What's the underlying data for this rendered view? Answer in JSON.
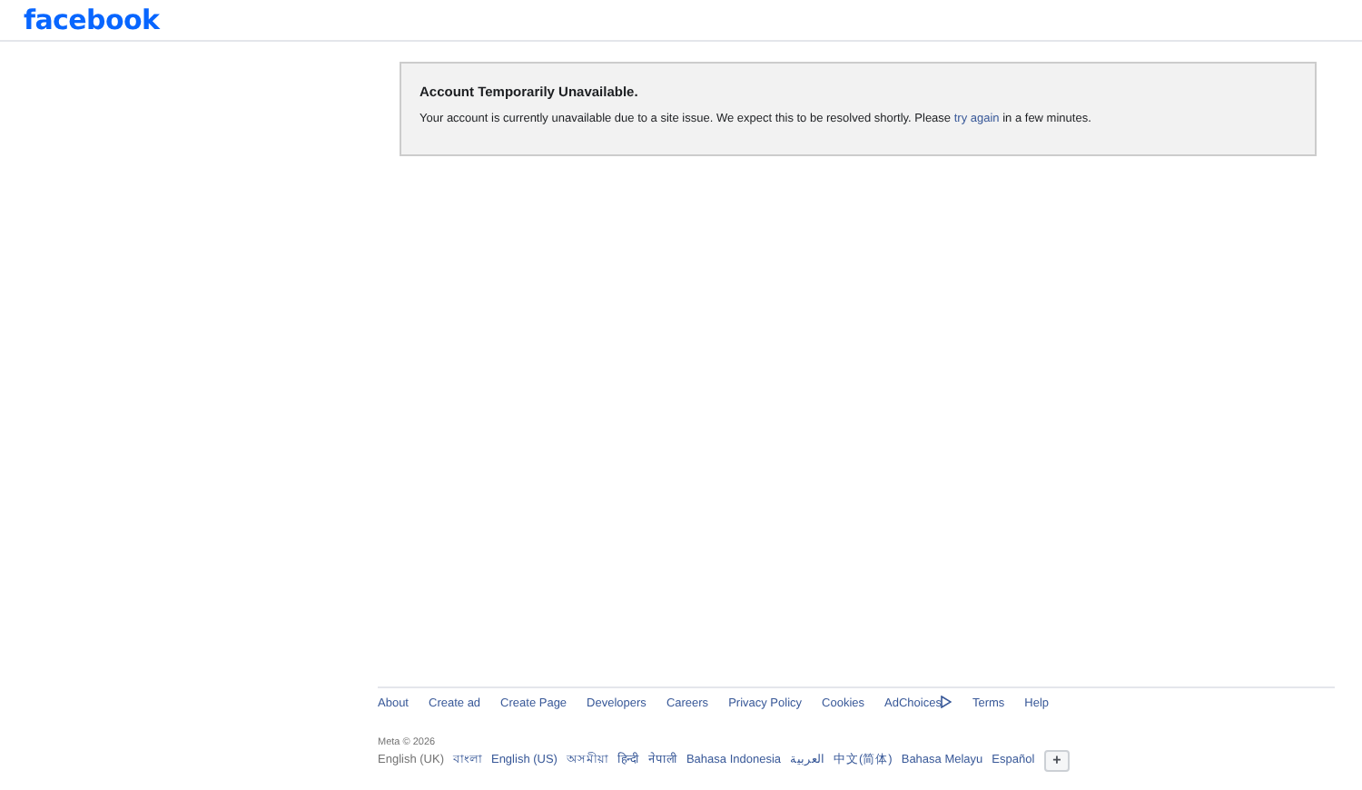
{
  "header": {
    "logo": "facebook"
  },
  "notice": {
    "title": "Account Temporarily Unavailable.",
    "message_before": "Your account is currently unavailable due to a site issue. We expect this to be resolved shortly. Please ",
    "link": "try again",
    "message_after": " in a few minutes."
  },
  "footer": {
    "links": [
      {
        "label": "About"
      },
      {
        "label": "Create ad"
      },
      {
        "label": "Create Page"
      },
      {
        "label": "Developers"
      },
      {
        "label": "Careers"
      },
      {
        "label": "Privacy Policy"
      },
      {
        "label": "Cookies"
      },
      {
        "label": "AdChoices",
        "kind": "adchoices"
      },
      {
        "label": "Terms"
      },
      {
        "label": "Help"
      }
    ],
    "copyright": "Meta © 2026",
    "languages": [
      {
        "label": "English (UK)",
        "selected": true
      },
      {
        "label": "বাংলা",
        "selected": false
      },
      {
        "label": "English (US)",
        "selected": false
      },
      {
        "label": "অসমীয়া",
        "selected": false
      },
      {
        "label": "हिन्दी",
        "selected": false
      },
      {
        "label": "नेपाली",
        "selected": false
      },
      {
        "label": "Bahasa Indonesia",
        "selected": false
      },
      {
        "label": "العربية",
        "selected": false
      },
      {
        "label": "中文(简体)",
        "selected": false
      },
      {
        "label": "Bahasa Melayu",
        "selected": false
      },
      {
        "label": "Español",
        "selected": false
      }
    ],
    "more_button": "+"
  }
}
